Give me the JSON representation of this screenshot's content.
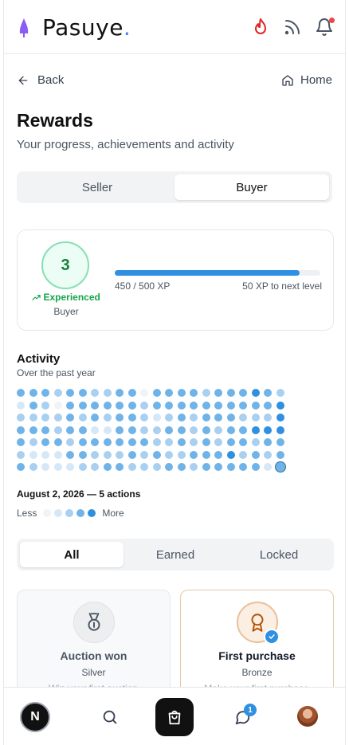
{
  "header": {
    "brand": "Pasuye",
    "brand_dot": ".",
    "icons": [
      "flame-icon",
      "rss-icon",
      "bell-icon"
    ],
    "accent": "#3b82f6"
  },
  "nav": {
    "back_label": "Back",
    "home_label": "Home"
  },
  "page": {
    "title": "Rewards",
    "subtitle": "Your progress, achievements and activity"
  },
  "role_toggle": {
    "options": [
      "Seller",
      "Buyer"
    ],
    "selected": "Buyer"
  },
  "level": {
    "number": "3",
    "name": "Experienced",
    "role": "Buyer",
    "xp_text": "450 / 500 XP",
    "next_text": "50 XP to next level",
    "progress": 0.9,
    "color": "#16a34a"
  },
  "activity": {
    "title": "Activity",
    "subtitle": "Over the past year",
    "selected_day": "August 2, 2026 — 5 actions",
    "legend_less": "Less",
    "legend_more": "More",
    "levels_colors": [
      "#f1f3f5",
      "#d6e8f8",
      "#a9d0f0",
      "#6fb3e8",
      "#2f8fe0"
    ],
    "grid": [
      [
        3,
        3,
        3,
        2,
        3,
        3,
        2,
        2,
        3,
        3,
        0,
        3,
        3,
        3,
        3,
        2,
        3,
        3,
        3,
        4,
        3,
        2
      ],
      [
        1,
        3,
        2,
        0,
        3,
        3,
        3,
        3,
        3,
        3,
        2,
        3,
        3,
        3,
        3,
        3,
        3,
        3,
        3,
        3,
        3,
        4
      ],
      [
        2,
        2,
        2,
        2,
        3,
        2,
        3,
        2,
        3,
        3,
        2,
        1,
        2,
        3,
        2,
        3,
        3,
        3,
        2,
        2,
        2,
        4
      ],
      [
        3,
        3,
        3,
        2,
        3,
        3,
        1,
        1,
        3,
        3,
        2,
        2,
        3,
        3,
        2,
        3,
        2,
        3,
        3,
        4,
        4,
        4
      ],
      [
        3,
        2,
        3,
        3,
        2,
        3,
        3,
        3,
        3,
        3,
        3,
        2,
        2,
        3,
        2,
        3,
        2,
        3,
        3,
        2,
        3,
        3
      ],
      [
        2,
        1,
        1,
        1,
        3,
        3,
        2,
        2,
        2,
        3,
        2,
        3,
        2,
        2,
        3,
        3,
        3,
        4,
        2,
        3,
        2,
        3
      ],
      [
        3,
        2,
        1,
        1,
        1,
        2,
        2,
        3,
        3,
        2,
        2,
        2,
        3,
        3,
        2,
        3,
        3,
        3,
        3,
        3,
        1,
        3
      ]
    ]
  },
  "filter_tabs": {
    "options": [
      "All",
      "Earned",
      "Locked"
    ],
    "selected": "All"
  },
  "badges": [
    {
      "title": "Auction won",
      "tier": "Silver",
      "icon": "medal-icon",
      "earned": false,
      "desc": "Win your first auction"
    },
    {
      "title": "First purchase",
      "tier": "Bronze",
      "icon": "award-icon",
      "earned": true,
      "desc": "Make your first purchase"
    }
  ],
  "bottom_nav": {
    "items": [
      "home-n-icon",
      "search-icon",
      "shopping-bag-icon",
      "messages-icon",
      "avatar"
    ],
    "initial": "N",
    "message_count": "1"
  }
}
